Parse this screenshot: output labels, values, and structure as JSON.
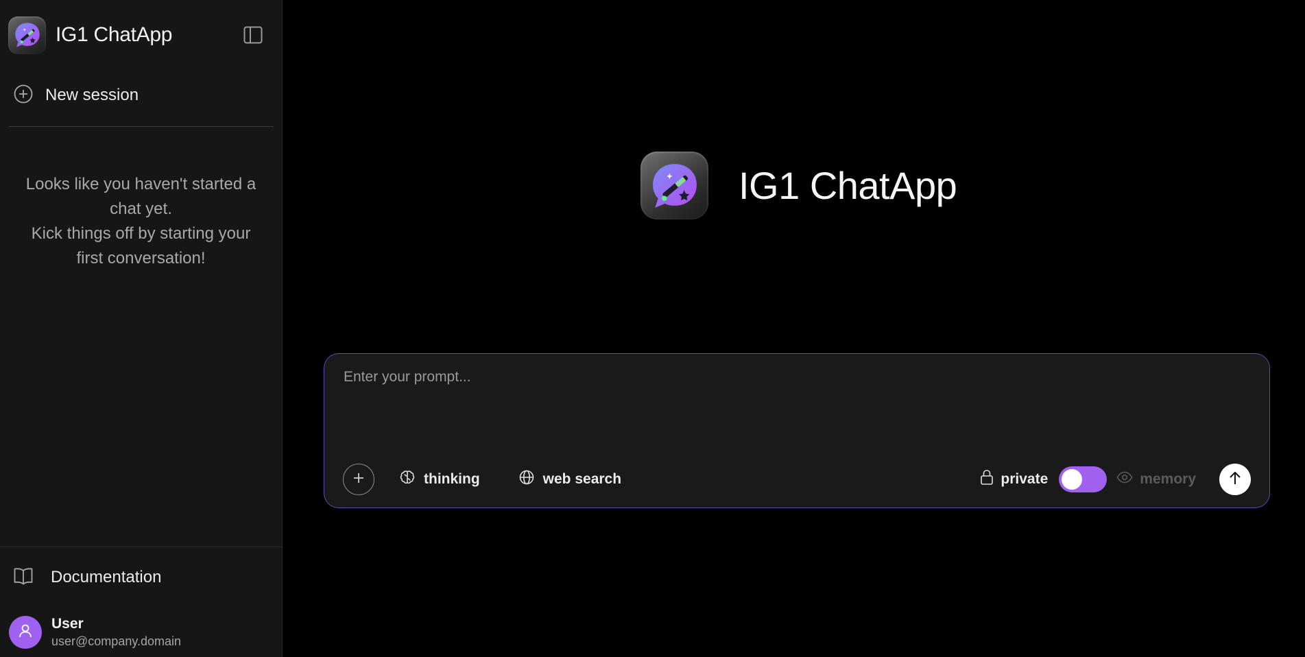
{
  "app": {
    "title": "IG1 ChatApp"
  },
  "sidebar": {
    "new_session_label": "New session",
    "empty_message": {
      "line1": "Looks like you haven't started a chat yet.",
      "line2": "Kick things off by starting your first conversation!"
    },
    "documentation_label": "Documentation",
    "user": {
      "name": "User",
      "email": "user@company.domain"
    }
  },
  "main": {
    "hero_title": "IG1 ChatApp",
    "composer": {
      "placeholder": "Enter your prompt...",
      "thinking_label": "thinking",
      "web_search_label": "web search",
      "private_label": "private",
      "private_enabled": true,
      "memory_label": "memory"
    }
  },
  "icons": {
    "logo": "chat-bubble-magic-wand-icon",
    "sidebar_toggle": "sidebar-toggle-icon",
    "new_session": "plus-circle-icon",
    "documentation": "book-open-icon",
    "avatar": "user-icon",
    "attach": "plus-icon",
    "thinking": "brain-icon",
    "web_search": "globe-icon",
    "private": "lock-icon",
    "memory": "eye-icon",
    "send": "arrow-up-icon"
  },
  "colors": {
    "accent": "#a061f0",
    "composer_border": "#5b4bb3",
    "sidebar_bg": "#161616",
    "main_bg": "#000000"
  }
}
